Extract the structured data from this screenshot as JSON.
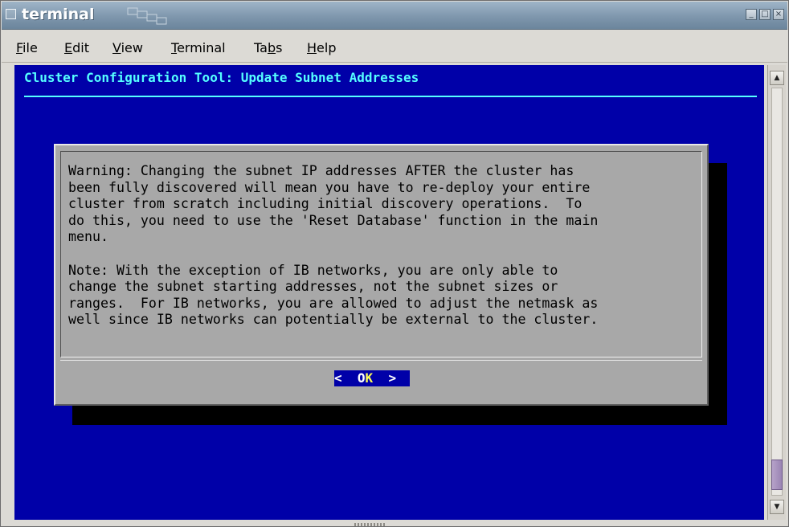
{
  "window": {
    "title": "terminal",
    "minimize_label": "_",
    "maximize_label": "□",
    "close_label": "×"
  },
  "menubar": {
    "items": [
      {
        "label": "File",
        "mnemonic": "F"
      },
      {
        "label": "Edit",
        "mnemonic": "E"
      },
      {
        "label": "View",
        "mnemonic": "V"
      },
      {
        "label": "Terminal",
        "mnemonic": "T"
      },
      {
        "label": "Tabs",
        "mnemonic": "b"
      },
      {
        "label": "Help",
        "mnemonic": "H"
      }
    ]
  },
  "terminal": {
    "screen_title": "Cluster Configuration Tool: Update Subnet Addresses",
    "dialog_text": "Warning: Changing the subnet IP addresses AFTER the cluster has\nbeen fully discovered will mean you have to re-deploy your entire\ncluster from scratch including initial discovery operations.  To\ndo this, you need to use the 'Reset Database' function in the main\nmenu.\n\nNote: With the exception of IB networks, you are only able to\nchange the subnet starting addresses, not the subnet sizes or\nranges.  For IB networks, you are allowed to adjust the netmask as\nwell since IB networks can potentially be external to the cluster.",
    "ok_button": {
      "left": "<  ",
      "prefix": "O",
      "hotkey": "K",
      "right": "  >"
    }
  },
  "scrollbar": {
    "up_icon": "▲",
    "down_icon": "▼"
  },
  "colors": {
    "terminal_bg": "#0000a8",
    "title_fg": "#55ffff",
    "dialog_bg": "#a8a8a8",
    "hotkey": "#ffff55",
    "scroll_thumb": "#9a84b3"
  }
}
